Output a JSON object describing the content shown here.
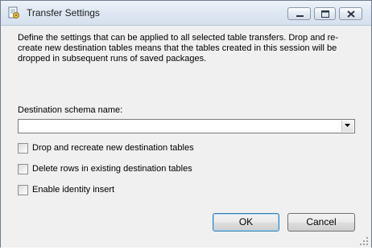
{
  "window": {
    "title": "Transfer Settings",
    "icon": "document-settings-icon"
  },
  "caption_buttons": {
    "minimize_icon": "minimize-icon",
    "maximize_icon": "maximize-icon",
    "close_icon": "close-icon"
  },
  "description": "Define the settings that can be applied to all selected table transfers. Drop and re-create new destination tables means that the tables created in this session will be dropped in subsequent runs of saved packages.",
  "schema": {
    "label": "Destination schema name:",
    "value": ""
  },
  "options": [
    {
      "label": "Drop and recreate new destination tables",
      "checked": false
    },
    {
      "label": "Delete rows in existing destination tables",
      "checked": false
    },
    {
      "label": "Enable identity insert",
      "checked": false
    }
  ],
  "buttons": {
    "ok": "OK",
    "cancel": "Cancel"
  },
  "colors": {
    "accent": "#3c7fb1",
    "close_red": "#c75050"
  }
}
